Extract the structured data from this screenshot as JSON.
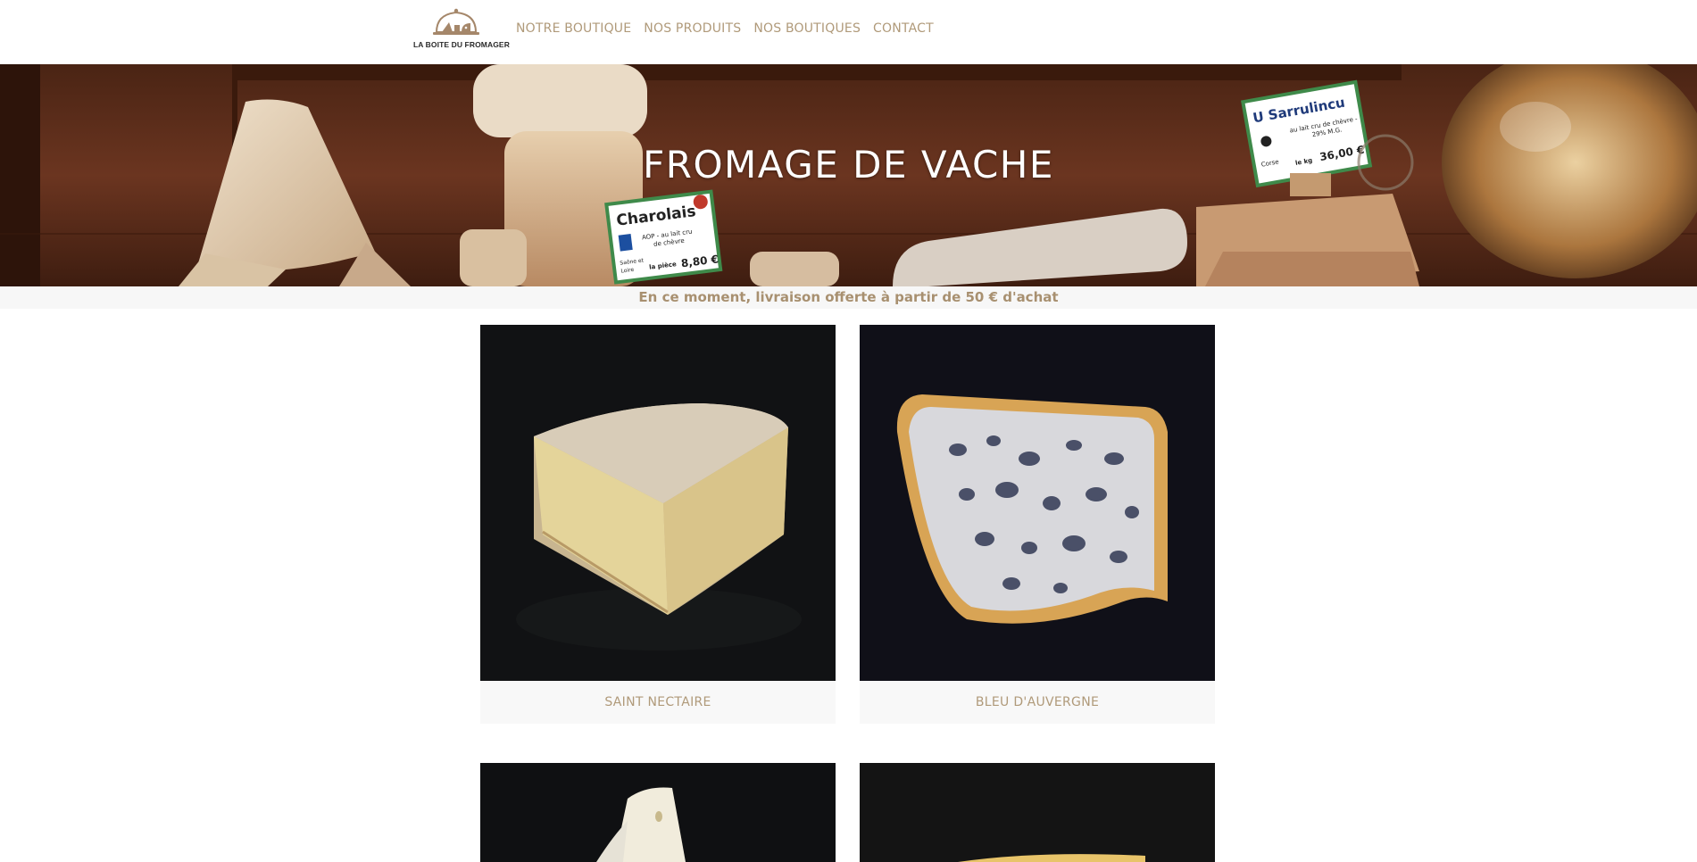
{
  "brand": {
    "name": "LA BOITE DU FROMAGER",
    "logo_icon": "cheese-cloche-logo",
    "color": "#a08868"
  },
  "nav": {
    "items": [
      {
        "label": "NOTRE BOUTIQUE"
      },
      {
        "label": "NOS PRODUITS"
      },
      {
        "label": "NOS BOUTIQUES"
      },
      {
        "label": "CONTACT"
      }
    ]
  },
  "hero": {
    "title": "FROMAGE DE VACHE"
  },
  "promo": {
    "text": "En ce moment, livraison offerte à partir de 50 € d'achat"
  },
  "hero_labels": {
    "charolais": {
      "name": "Charolais",
      "line1": "AOP - au lait cru",
      "line2": "de chèvre",
      "origin1": "Saône et",
      "origin2": "Loire",
      "unit": "la pièce",
      "price": "8,80 €"
    },
    "sarrulincu": {
      "name": "U Sarrulincu",
      "line1": "au lait cru de chèvre -",
      "line2": "29% M.G.",
      "origin": "Corse",
      "unit": "le kg",
      "price": "36,00 €"
    }
  },
  "products": [
    {
      "name": "SAINT NECTAIRE",
      "icon": "saint-nectaire-photo"
    },
    {
      "name": "BLEU D'AUVERGNE",
      "icon": "bleu-auvergne-photo"
    },
    {
      "name": "",
      "icon": "white-rind-cheese-photo"
    },
    {
      "name": "",
      "icon": "hard-cheese-photo"
    }
  ]
}
